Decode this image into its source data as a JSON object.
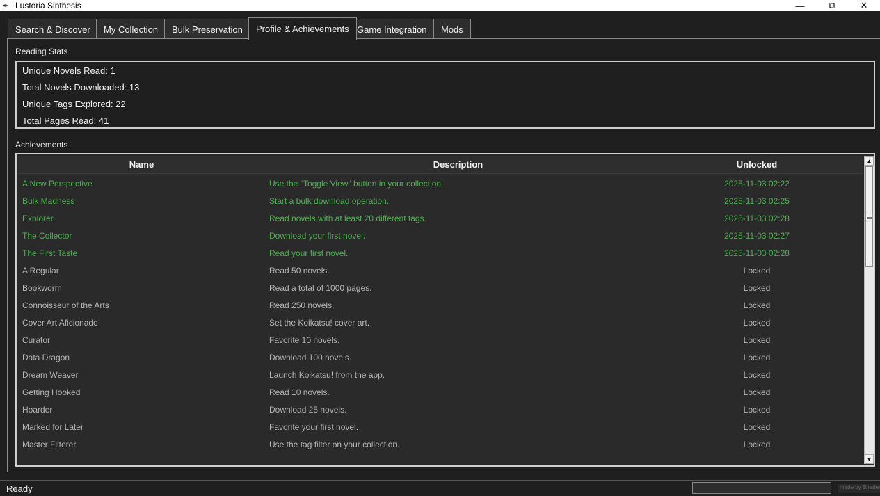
{
  "window": {
    "title": "Lustoria Sinthesis",
    "icon": "feather-icon",
    "controls": [
      "minimize-icon",
      "restore-icon",
      "close-icon"
    ]
  },
  "tabs": [
    {
      "label": "Search & Discover",
      "active": false
    },
    {
      "label": "My Collection",
      "active": false
    },
    {
      "label": "Bulk Preservation",
      "active": false
    },
    {
      "label": "Profile & Achievements",
      "active": true
    },
    {
      "label": "Game Integration",
      "active": false
    },
    {
      "label": "Mods",
      "active": false
    }
  ],
  "reading_stats": {
    "label": "Reading Stats",
    "lines": [
      "Unique Novels Read: 1",
      "Total Novels Downloaded: 13",
      "Unique Tags Explored: 22",
      "Total Pages Read: 41"
    ]
  },
  "achievements": {
    "label": "Achievements",
    "columns": [
      "Name",
      "Description",
      "Unlocked"
    ],
    "rows": [
      {
        "name": "A New Perspective",
        "description": "Use the \"Toggle View\" button in your collection.",
        "unlocked": "2025-11-03 02:22",
        "status": "unlocked"
      },
      {
        "name": "Bulk Madness",
        "description": "Start a bulk download operation.",
        "unlocked": "2025-11-03 02:25",
        "status": "unlocked"
      },
      {
        "name": "Explorer",
        "description": "Read novels with at least 20 different tags.",
        "unlocked": "2025-11-03 02:28",
        "status": "unlocked"
      },
      {
        "name": "The Collector",
        "description": "Download your first novel.",
        "unlocked": "2025-11-03 02:27",
        "status": "unlocked"
      },
      {
        "name": "The First Taste",
        "description": "Read your first novel.",
        "unlocked": "2025-11-03 02:28",
        "status": "unlocked"
      },
      {
        "name": "A Regular",
        "description": "Read 50 novels.",
        "unlocked": "Locked",
        "status": "locked"
      },
      {
        "name": "Bookworm",
        "description": "Read a total of 1000 pages.",
        "unlocked": "Locked",
        "status": "locked"
      },
      {
        "name": "Connoisseur of the Arts",
        "description": "Read 250 novels.",
        "unlocked": "Locked",
        "status": "locked"
      },
      {
        "name": "Cover Art Aficionado",
        "description": "Set the Koikatsu! cover art.",
        "unlocked": "Locked",
        "status": "locked"
      },
      {
        "name": "Curator",
        "description": "Favorite 10 novels.",
        "unlocked": "Locked",
        "status": "locked"
      },
      {
        "name": "Data Dragon",
        "description": "Download 100 novels.",
        "unlocked": "Locked",
        "status": "locked"
      },
      {
        "name": "Dream Weaver",
        "description": "Launch Koikatsu! from the app.",
        "unlocked": "Locked",
        "status": "locked"
      },
      {
        "name": "Getting Hooked",
        "description": "Read 10 novels.",
        "unlocked": "Locked",
        "status": "locked"
      },
      {
        "name": "Hoarder",
        "description": "Download 25 novels.",
        "unlocked": "Locked",
        "status": "locked"
      },
      {
        "name": "Marked for Later",
        "description": "Favorite your first novel.",
        "unlocked": "Locked",
        "status": "locked"
      },
      {
        "name": "Master Filterer",
        "description": "Use the tag filter on your collection.",
        "unlocked": "Locked",
        "status": "locked"
      }
    ]
  },
  "status_bar": {
    "text": "Ready",
    "progress_fraction": 0,
    "credit": "made by Shaden"
  },
  "colors": {
    "background": "#1f1f1f",
    "unlocked_text": "#4caf50",
    "locked_text": "#b4b4b4",
    "border": "#cfcfcf"
  }
}
